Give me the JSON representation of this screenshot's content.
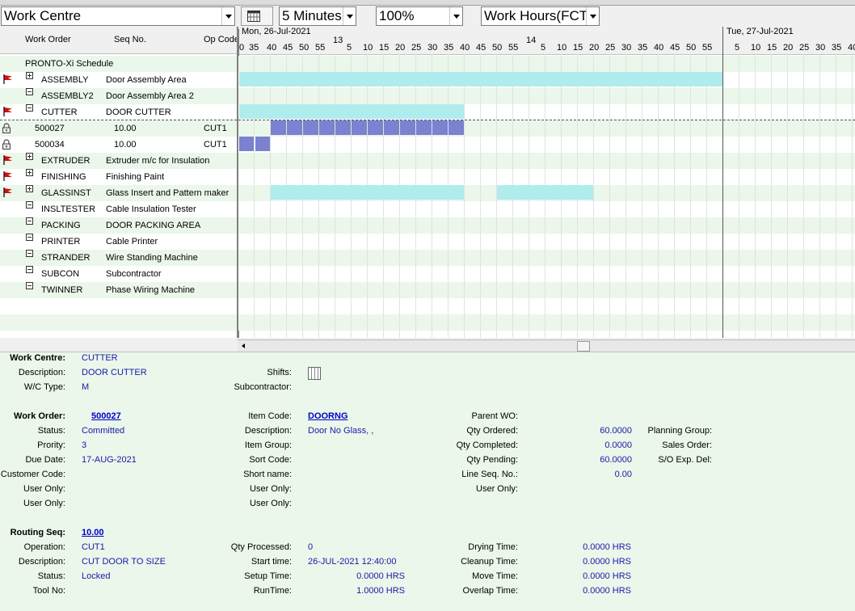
{
  "toolbar": {
    "view_select": "Work Centre",
    "interval_select": "5 Minutes",
    "zoom_select": "100%",
    "hours_select": "Work Hours(FCT"
  },
  "columns": {
    "work_order": "Work Order",
    "seq_no": "Seq No.",
    "op_code": "Op Code"
  },
  "timeline": {
    "day1": "Mon, 26-Jul-2021",
    "day2": "Tue, 27-Jul-2021",
    "hour13": "13",
    "hour14": "14",
    "minute_ticks_a": [
      "0",
      "35",
      "40",
      "45",
      "50",
      "55"
    ],
    "minute_ticks_b": [
      "5",
      "10",
      "15",
      "20",
      "25",
      "30",
      "35",
      "40",
      "45",
      "50",
      "55"
    ],
    "minute_ticks_c": [
      "5",
      "10",
      "15",
      "20",
      "25",
      "30",
      "35",
      "40",
      "45",
      "50",
      "55"
    ],
    "minute_ticks_d": [
      "5",
      "10",
      "15",
      "20",
      "25",
      "30",
      "35",
      "40"
    ]
  },
  "tree": [
    {
      "code": "PRONTO-Xi Schedule",
      "desc": "",
      "toggle": "none",
      "flag": false,
      "lock": false,
      "seq": "",
      "op": ""
    },
    {
      "code": "ASSEMBLY",
      "desc": "Door Assembly Area",
      "toggle": "plus",
      "flag": true,
      "lock": false,
      "seq": "",
      "op": ""
    },
    {
      "code": "ASSEMBLY2",
      "desc": "Door Assembly Area 2",
      "toggle": "minus",
      "flag": false,
      "lock": false,
      "seq": "",
      "op": ""
    },
    {
      "code": "CUTTER",
      "desc": "DOOR CUTTER",
      "toggle": "minus",
      "flag": true,
      "lock": false,
      "seq": "",
      "op": ""
    },
    {
      "code": "500027",
      "desc": "",
      "toggle": "none",
      "flag": false,
      "lock": true,
      "seq": "10.00",
      "op": "CUT1"
    },
    {
      "code": "500034",
      "desc": "",
      "toggle": "none",
      "flag": false,
      "lock": true,
      "seq": "10.00",
      "op": "CUT1"
    },
    {
      "code": "EXTRUDER",
      "desc": "Extruder m/c for Insulation",
      "toggle": "plus",
      "flag": true,
      "lock": false,
      "seq": "",
      "op": ""
    },
    {
      "code": "FINISHING",
      "desc": "Finishing Paint",
      "toggle": "plus",
      "flag": true,
      "lock": false,
      "seq": "",
      "op": ""
    },
    {
      "code": "GLASSINST",
      "desc": "Glass Insert and Pattern maker",
      "toggle": "plus",
      "flag": true,
      "lock": false,
      "seq": "",
      "op": ""
    },
    {
      "code": "INSLTESTER",
      "desc": "Cable Insulation Tester",
      "toggle": "minus",
      "flag": false,
      "lock": false,
      "seq": "",
      "op": ""
    },
    {
      "code": "PACKING",
      "desc": "DOOR PACKING AREA",
      "toggle": "minus",
      "flag": false,
      "lock": false,
      "seq": "",
      "op": ""
    },
    {
      "code": "PRINTER",
      "desc": "Cable Printer",
      "toggle": "minus",
      "flag": false,
      "lock": false,
      "seq": "",
      "op": ""
    },
    {
      "code": "STRANDER",
      "desc": "Wire Standing Machine",
      "toggle": "minus",
      "flag": false,
      "lock": false,
      "seq": "",
      "op": ""
    },
    {
      "code": "SUBCON",
      "desc": "Subcontractor",
      "toggle": "minus",
      "flag": false,
      "lock": false,
      "seq": "",
      "op": ""
    },
    {
      "code": "TWINNER",
      "desc": "Phase Wiring Machine",
      "toggle": "minus",
      "flag": false,
      "lock": false,
      "seq": "",
      "op": ""
    }
  ],
  "details": {
    "wc": {
      "work_centre_label": "Work Centre:",
      "work_centre": "CUTTER",
      "description_label": "Description:",
      "description": "DOOR CUTTER",
      "wc_type_label": "W/C Type:",
      "wc_type": "M",
      "shifts_label": "Shifts:",
      "subcontractor_label": "Subcontractor:"
    },
    "wo": {
      "work_order_label": "Work Order:",
      "work_order": "500027",
      "status_label": "Status:",
      "status": "Committed",
      "priority_label": "Prority:",
      "priority": "3",
      "due_date_label": "Due Date:",
      "due_date": "17-AUG-2021",
      "customer_code_label": "Customer Code:",
      "user_only_1_label": "User Only:",
      "user_only_2_label": "User Only:",
      "item_code_label": "Item Code:",
      "item_code": "DOORNG",
      "item_desc_label": "Description:",
      "item_desc": "Door No Glass,  ,",
      "item_group_label": "Item Group:",
      "sort_code_label": "Sort Code:",
      "short_name_label": "Short name:",
      "user_only_3_label": "User Only:",
      "user_only_4_label": "User Only:",
      "parent_wo_label": "Parent WO:",
      "qty_ordered_label": "Qty Ordered:",
      "qty_ordered": "60.0000",
      "qty_completed_label": "Qty Completed:",
      "qty_completed": "0.0000",
      "qty_pending_label": "Qty Pending:",
      "qty_pending": "60.0000",
      "line_seq_label": "Line Seq. No.:",
      "line_seq": "0.00",
      "user_only_5_label": "User Only:",
      "planning_group_label": "Planning Group:",
      "sales_order_label": "Sales Order:",
      "so_exp_del_label": "S/O Exp. Del:"
    },
    "rs": {
      "routing_seq_label": "Routing Seq:",
      "routing_seq": "10.00",
      "operation_label": "Operation:",
      "operation": "CUT1",
      "description_label": "Description:",
      "description": "CUT DOOR TO SIZE",
      "status_label": "Status:",
      "status": "Locked",
      "tool_no_label": "Tool No:",
      "qty_processed_label": "Qty Processed:",
      "qty_processed": "0",
      "start_time_label": "Start time:",
      "start_time": "26-JUL-2021 12:40:00",
      "setup_time_label": "Setup Time:",
      "setup_time": "0.0000 HRS",
      "run_time_label": "RunTime:",
      "run_time": "1.0000 HRS",
      "drying_time_label": "Drying Time:",
      "drying_time": "0.0000 HRS",
      "cleanup_time_label": "Cleanup Time:",
      "cleanup_time": "0.0000 HRS",
      "move_time_label": "Move Time:",
      "move_time": "0.0000 HRS",
      "overlap_time_label": "Overlap Time:",
      "overlap_time": "0.0000 HRS"
    }
  },
  "colors": {
    "panel_bg": "#eaf7ea",
    "bar_cyan": "#b0ecee",
    "bar_blue": "#7b82d0",
    "value_text": "#1a1aa8"
  }
}
